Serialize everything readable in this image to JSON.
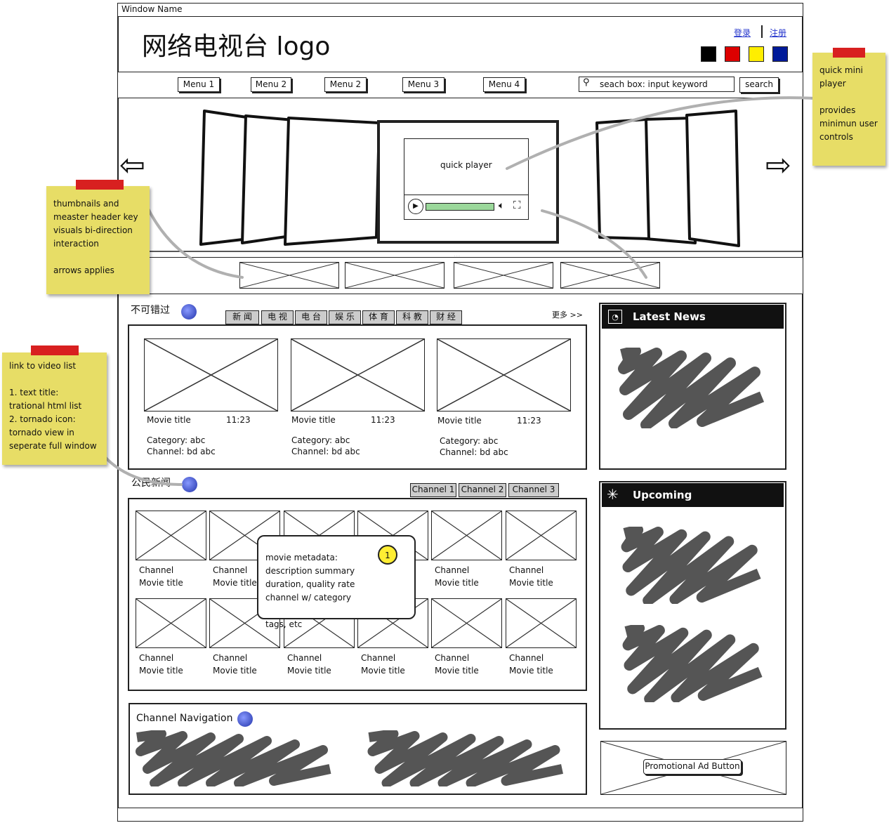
{
  "window": {
    "title": "Window Name"
  },
  "header": {
    "logo": "网络电视台 logo",
    "login": "登录",
    "register": "注册",
    "swatches": [
      "#000000",
      "#dd0000",
      "#ffee00",
      "#001a99"
    ]
  },
  "nav": {
    "menus": [
      "Menu 1",
      "Menu 2",
      "Menu 2",
      "Menu 3",
      "Menu 4"
    ],
    "search_placeholder": "seach box: input keyword",
    "search_button": "search"
  },
  "player": {
    "label": "quick player"
  },
  "section1": {
    "title": "不可错过",
    "more": "更多 >>",
    "tabs": [
      "新 闻",
      "电 视",
      "电 台",
      "娱 乐",
      "体 育",
      "科 教",
      "财 经"
    ],
    "items": [
      {
        "title": "Movie title",
        "time": "11:23",
        "category": "Category: abc",
        "channel": "Channel:  bd abc"
      },
      {
        "title": "Movie title",
        "time": "11:23",
        "category": "Category: abc",
        "channel": "Channel:  bd abc"
      },
      {
        "title": "Movie title",
        "time": "11:23",
        "category": "Category: abc",
        "channel": "Channel:  bd abc"
      }
    ]
  },
  "section2": {
    "title": "公民新闻",
    "tabs": [
      "Channel 1",
      "Channel 2",
      "Channel 3"
    ],
    "channel_label": "Channel",
    "movie_label": "Movie title"
  },
  "tooltip": {
    "lines": [
      "movie metadata:",
      "description summary",
      "duration, quality rate",
      "channel w/ category",
      "",
      "tags, etc"
    ],
    "badge": "1"
  },
  "channel_nav": {
    "title": "Channel Navigation"
  },
  "sidebar": {
    "latest_news": "Latest News",
    "upcoming": "Upcoming",
    "promo": "Promotional Ad Button"
  },
  "notes": {
    "mini_player": "quick mini\nplayer\n\nprovides\nminimun user\ncontrols",
    "thumbnails": "thumbnails and\nmeaster header key\nvisuals bi-direction\ninteraction\n\narrows applies",
    "video_list": "link to video list\n\n1. text title:\ntrational html list\n2. tornado icon:\ntornado view in\nseperate full window"
  }
}
